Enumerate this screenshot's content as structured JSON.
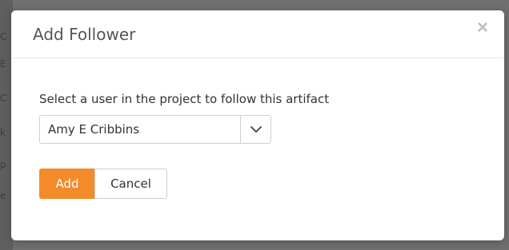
{
  "dialog": {
    "title": "Add Follower",
    "close_symbol": "×",
    "instruction": "Select a user in the project to follow this artifact",
    "user_select": {
      "selected_value": "Amy E Cribbins"
    },
    "buttons": {
      "add_label": "Add",
      "cancel_label": "Cancel"
    }
  },
  "background": {
    "partial_letters": [
      "C",
      "E",
      "C",
      "k",
      "p",
      "e"
    ]
  },
  "icons": {
    "close": "close-icon",
    "dropdown": "chevron-down-icon"
  },
  "colors": {
    "primary_button": "#f38b2b",
    "backdrop": "#6f6f6f",
    "dialog_background": "#ffffff"
  }
}
